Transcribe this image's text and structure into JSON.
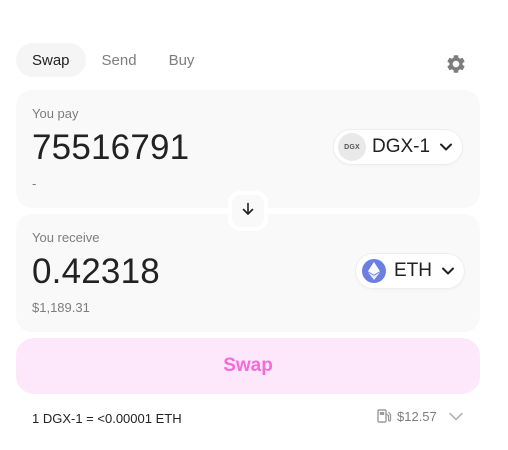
{
  "tabs": [
    {
      "label": "Swap",
      "active": true
    },
    {
      "label": "Send",
      "active": false
    },
    {
      "label": "Buy",
      "active": false
    }
  ],
  "pay": {
    "label": "You pay",
    "amount": "75516791",
    "fiat": "-",
    "token": {
      "symbol": "DGX-1",
      "logo_text": "DGX",
      "icon": "dgx-token-icon"
    }
  },
  "receive": {
    "label": "You receive",
    "amount": "0.42318",
    "fiat": "$1,189.31",
    "token": {
      "symbol": "ETH",
      "icon": "eth-token-icon",
      "color": "#6b7fe3"
    }
  },
  "swap_button": {
    "label": "Swap",
    "bg": "#fde8fb",
    "text_color": "#f46bd9"
  },
  "rate": "1 DGX-1 = <0.00001 ETH",
  "gas": {
    "value": "$12.57",
    "icon": "gas-pump-icon"
  },
  "icons": {
    "settings": "gear-icon",
    "switch": "arrow-down-icon"
  }
}
